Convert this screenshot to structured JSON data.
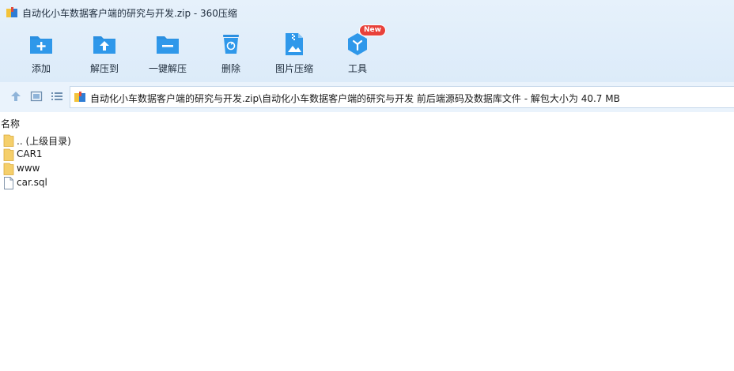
{
  "window": {
    "title": "自动化小车数据客户端的研究与开发.zip - 360压缩"
  },
  "toolbar": {
    "items": [
      {
        "label": "添加",
        "icon": "add-folder-icon"
      },
      {
        "label": "解压到",
        "icon": "extract-to-icon"
      },
      {
        "label": "一键解压",
        "icon": "one-click-extract-icon"
      },
      {
        "label": "删除",
        "icon": "trash-icon"
      },
      {
        "label": "图片压缩",
        "icon": "image-compress-icon"
      },
      {
        "label": "工具",
        "icon": "tools-icon",
        "badge": "New"
      }
    ],
    "accent_color": "#2b8fe0",
    "badge_color": "#e8413a"
  },
  "navbar": {
    "address": "自动化小车数据客户端的研究与开发.zip\\自动化小车数据客户端的研究与开发 前后端源码及数据库文件 - 解包大小为 40.7 MB"
  },
  "file_list": {
    "column_header": "名称",
    "rows": [
      {
        "name": ".. (上级目录)",
        "type": "folder"
      },
      {
        "name": "CAR1",
        "type": "folder"
      },
      {
        "name": "www",
        "type": "folder"
      },
      {
        "name": "car.sql",
        "type": "file"
      }
    ]
  }
}
